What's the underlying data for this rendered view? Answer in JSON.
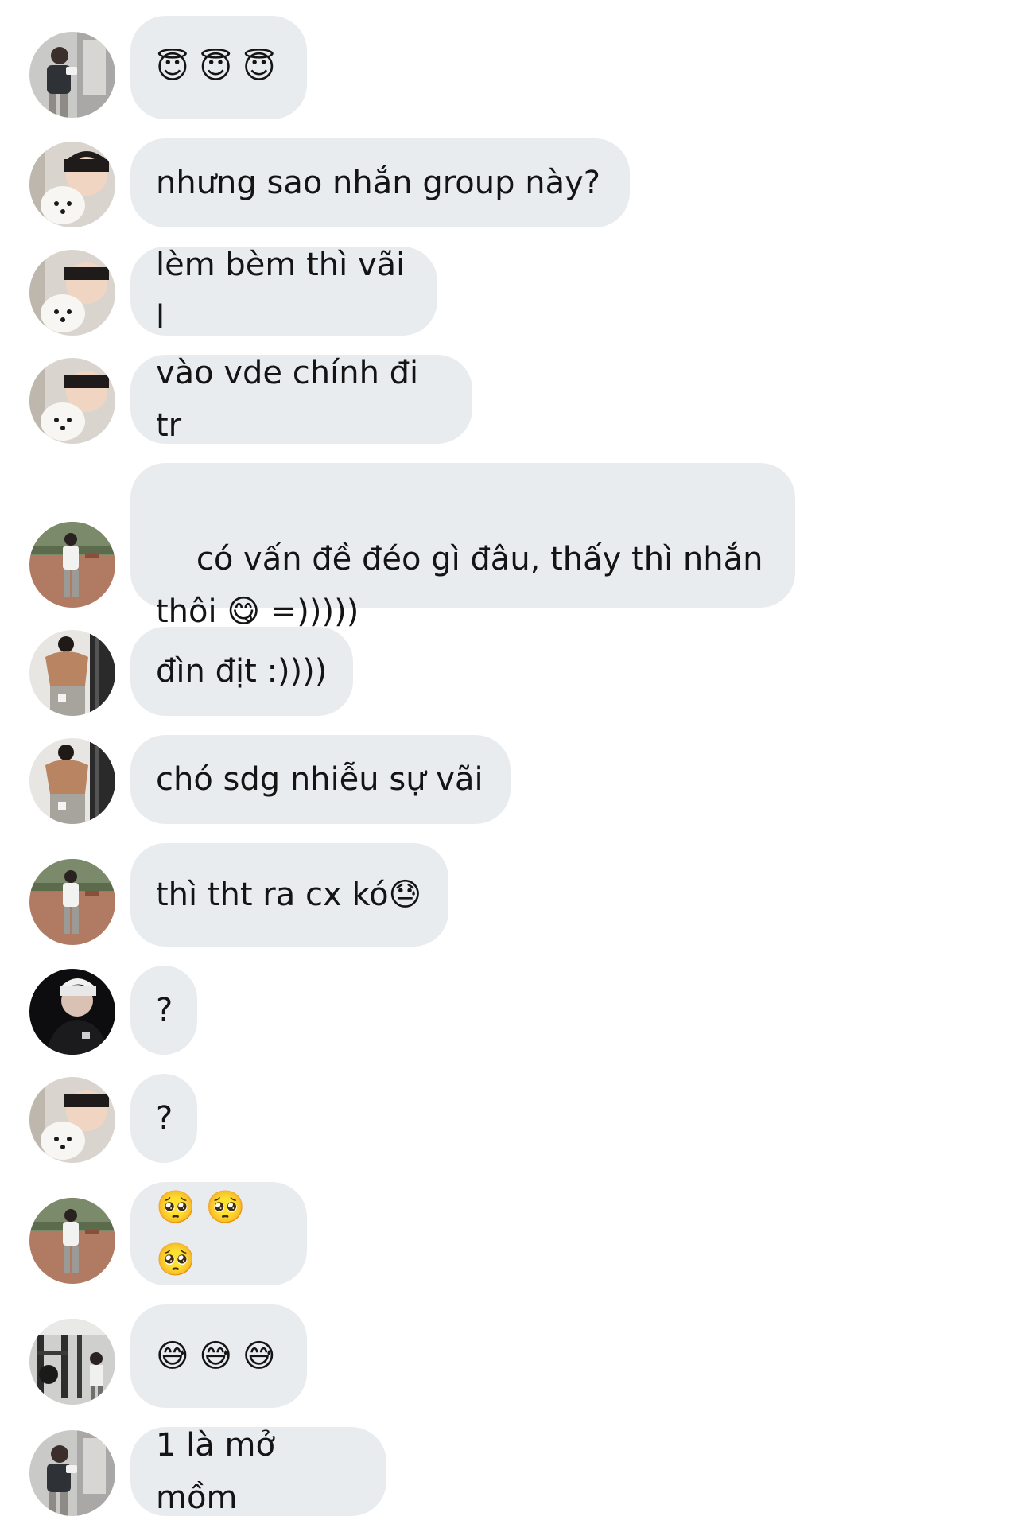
{
  "messages": [
    {
      "id": "m1",
      "avatar": "avatar-a-mirror",
      "text": "😇 😇 😇"
    },
    {
      "id": "m2",
      "avatar": "avatar-b-dog",
      "text": "nhưng sao nhắn group này?"
    },
    {
      "id": "m3",
      "avatar": "avatar-b-dog",
      "text": "lèm bèm thì vãi l"
    },
    {
      "id": "m4",
      "avatar": "avatar-b-dog",
      "text": "vào vde chính đi tr"
    },
    {
      "id": "m5",
      "avatar": "avatar-c-patio",
      "text": "có vấn đề đéo gì đâu, thấy thì nhắn thôi 😋 =)))))"
    },
    {
      "id": "m6",
      "avatar": "avatar-d-gym-back",
      "text": "đìn địt :))))"
    },
    {
      "id": "m7",
      "avatar": "avatar-d-gym-back",
      "text": "chó sdg nhiễu sự vãi"
    },
    {
      "id": "m8",
      "avatar": "avatar-c-patio",
      "text": "thì tht ra cx kó😓"
    },
    {
      "id": "m9",
      "avatar": "avatar-e-dark",
      "text": "?"
    },
    {
      "id": "m10",
      "avatar": "avatar-b-dog",
      "text": "?"
    },
    {
      "id": "m11",
      "avatar": "avatar-c-patio",
      "text": "🥺 🥺 🥺"
    },
    {
      "id": "m12",
      "avatar": "avatar-f-gym-room",
      "text": "😅 😅 😅"
    },
    {
      "id": "m13",
      "avatar": "avatar-a-mirror",
      "text": "1 là mở mồm"
    }
  ],
  "colors": {
    "bubble": "#e9ecef",
    "text": "#141414",
    "background": "#ffffff"
  }
}
